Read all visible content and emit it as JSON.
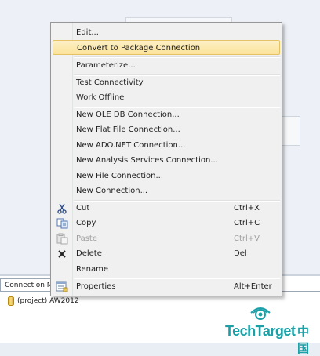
{
  "context_menu": {
    "items": [
      {
        "label": "Edit...",
        "shortcut": "",
        "icon": "",
        "state": "normal"
      },
      {
        "label": "Convert to Package Connection",
        "shortcut": "",
        "icon": "",
        "state": "highlighted"
      },
      {
        "label": "Parameterize...",
        "shortcut": "",
        "icon": "",
        "state": "normal"
      },
      {
        "label": "Test Connectivity",
        "shortcut": "",
        "icon": "",
        "state": "normal"
      },
      {
        "label": "Work Offline",
        "shortcut": "",
        "icon": "",
        "state": "normal"
      },
      {
        "label": "New OLE DB Connection...",
        "shortcut": "",
        "icon": "",
        "state": "normal"
      },
      {
        "label": "New Flat File Connection...",
        "shortcut": "",
        "icon": "",
        "state": "normal"
      },
      {
        "label": "New ADO.NET Connection...",
        "shortcut": "",
        "icon": "",
        "state": "normal"
      },
      {
        "label": "New Analysis Services Connection...",
        "shortcut": "",
        "icon": "",
        "state": "normal"
      },
      {
        "label": "New File Connection...",
        "shortcut": "",
        "icon": "",
        "state": "normal"
      },
      {
        "label": "New Connection...",
        "shortcut": "",
        "icon": "",
        "state": "normal"
      },
      {
        "label": "Cut",
        "shortcut": "Ctrl+X",
        "icon": "scissors-icon",
        "state": "normal"
      },
      {
        "label": "Copy",
        "shortcut": "Ctrl+C",
        "icon": "copy-icon",
        "state": "normal"
      },
      {
        "label": "Paste",
        "shortcut": "Ctrl+V",
        "icon": "paste-icon",
        "state": "disabled"
      },
      {
        "label": "Delete",
        "shortcut": "Del",
        "icon": "delete-x-icon",
        "state": "normal"
      },
      {
        "label": "Rename",
        "shortcut": "",
        "icon": "",
        "state": "normal"
      },
      {
        "label": "Properties",
        "shortcut": "Alt+Enter",
        "icon": "properties-icon",
        "state": "normal"
      }
    ]
  },
  "connection_managers": {
    "tab_label": "Connection Managers",
    "items": [
      {
        "label": "(project) AW2012",
        "icon": "database-icon"
      }
    ]
  },
  "watermark": {
    "brand": "TechTarget",
    "suffix": "中国",
    "icon": "eye-logo-icon",
    "color": "#1aa0a6"
  },
  "colors": {
    "highlight_fill": "#fbe39a",
    "highlight_border": "#e5c365",
    "menu_background": "#f0f0f0",
    "disabled_text": "#a0a0a0"
  }
}
